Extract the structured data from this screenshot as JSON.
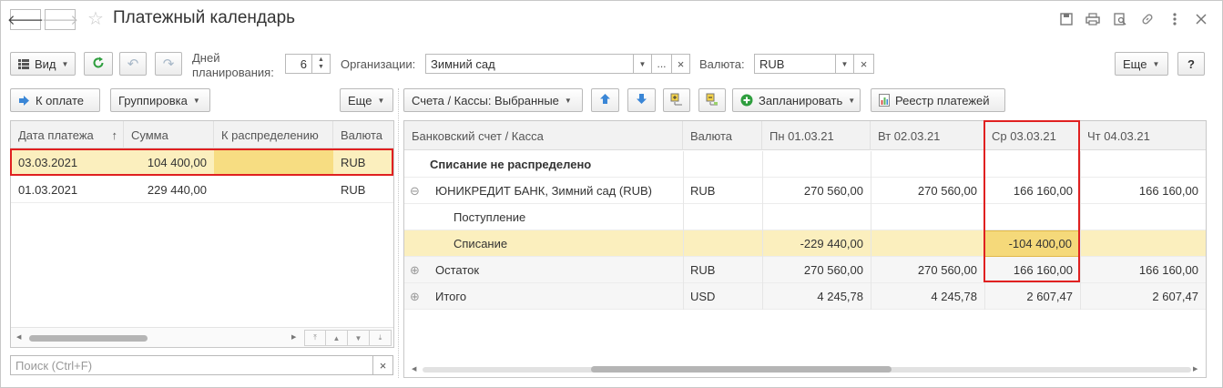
{
  "window": {
    "title": "Платежный календарь",
    "back_icon": "arrow-left-icon",
    "forward_icon": "arrow-right-icon",
    "favorite_icon": "star-icon",
    "title_icons": [
      "save-icon",
      "print-icon",
      "preview-icon",
      "link-icon",
      "more-icon",
      "close-icon"
    ]
  },
  "toolbar": {
    "view_label": "Вид",
    "days_label_1": "Дней",
    "days_label_2": "планирования:",
    "days_value": "6",
    "org_label": "Организации:",
    "org_value": "Зимний сад",
    "org_select_btn": "...",
    "clear_btn": "×",
    "currency_label": "Валюта:",
    "currency_value": "RUB",
    "more_label": "Еще",
    "help_label": "?"
  },
  "left_panel": {
    "pay_label": "К оплате",
    "group_label": "Группировка",
    "more_label": "Еще",
    "columns": [
      "Дата платежа",
      "Сумма",
      "К распределению",
      "Валюта"
    ],
    "sort_indicator": "↑",
    "rows": [
      {
        "date": "03.03.2021",
        "sum": "104 400,00",
        "distribute": "",
        "currency": "RUB"
      },
      {
        "date": "01.03.2021",
        "sum": "229 440,00",
        "distribute": "",
        "currency": "RUB"
      }
    ],
    "search_placeholder": "Поиск (Ctrl+F)",
    "search_clear": "×"
  },
  "right_panel": {
    "accounts_label": "Счета / Кассы: Выбранные",
    "plan_label": "Запланировать",
    "registry_label": "Реестр платежей",
    "columns": [
      "Банковский счет / Касса",
      "Валюта",
      "Пн 01.03.21",
      "Вт 02.03.21",
      "Ср 03.03.21",
      "Чт 04.03.21"
    ],
    "rows": [
      {
        "name": "Списание не распределено",
        "currency": "",
        "d1": "",
        "d2": "",
        "d3": "",
        "d4": "",
        "bold": true,
        "indent": 0,
        "marker": ""
      },
      {
        "name": "ЮНИКРЕДИТ БАНК, Зимний сад (RUB)",
        "currency": "RUB",
        "d1": "270 560,00",
        "d2": "270 560,00",
        "d3": "166 160,00",
        "d4": "166 160,00",
        "bold": false,
        "indent": 0,
        "marker": "⊖"
      },
      {
        "name": "Поступление",
        "currency": "",
        "d1": "",
        "d2": "",
        "d3": "",
        "d4": "",
        "bold": false,
        "indent": 1,
        "marker": ""
      },
      {
        "name": "Списание",
        "currency": "",
        "d1": "-229 440,00",
        "d2": "",
        "d3": "-104 400,00",
        "d4": "",
        "bold": false,
        "indent": 1,
        "marker": ""
      },
      {
        "name": "Остаток",
        "currency": "RUB",
        "d1": "270 560,00",
        "d2": "270 560,00",
        "d3": "166 160,00",
        "d4": "166 160,00",
        "bold": false,
        "indent": 0,
        "marker": "⊕"
      },
      {
        "name": "Итого",
        "currency": "USD",
        "d1": "4 245,78",
        "d2": "4 245,78",
        "d3": "2 607,47",
        "d4": "2 607,47",
        "bold": false,
        "indent": 0,
        "marker": "⊕"
      }
    ]
  },
  "colors": {
    "highlight": "#fbefbe",
    "selected_cell": "#f5d97a",
    "annotation": "#e02020",
    "refresh_green": "#2e9e3e",
    "arrow_blue": "#3a86d6"
  }
}
